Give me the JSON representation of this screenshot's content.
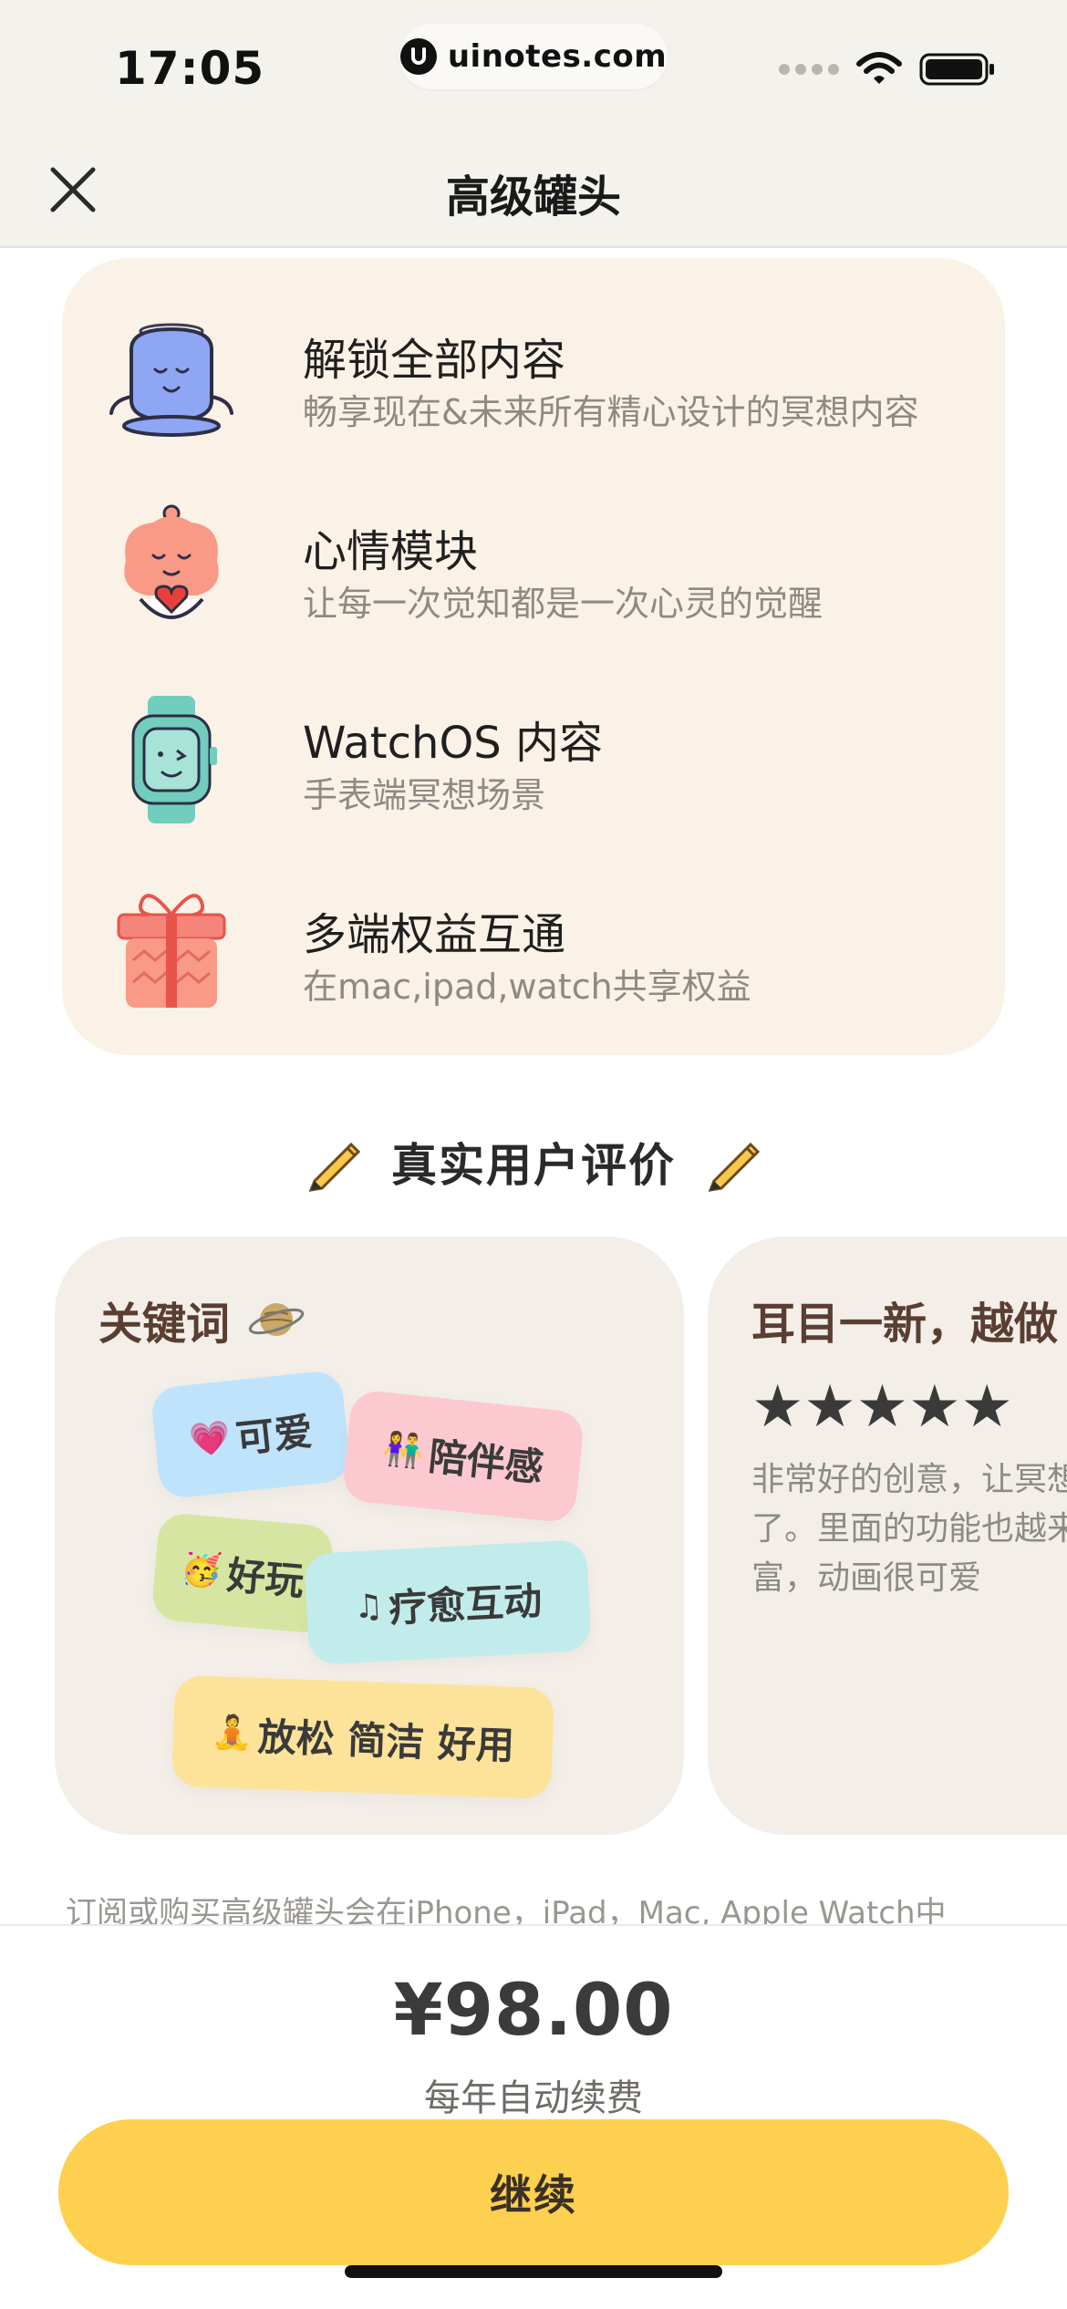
{
  "status_bar": {
    "time": "17:05",
    "url": "uinotes.com"
  },
  "nav": {
    "title": "高级罐头",
    "close_icon": "close-icon"
  },
  "features": [
    {
      "title": "解锁全部内容",
      "subtitle": "畅享现在&未来所有精心设计的冥想内容",
      "icon": "meditating-blob-icon"
    },
    {
      "title": "心情模块",
      "subtitle": "让每一次觉知都是一次心灵的觉醒",
      "icon": "mood-character-icon"
    },
    {
      "title": "WatchOS 内容",
      "subtitle": "手表端冥想场景",
      "icon": "watch-icon"
    },
    {
      "title": "多端权益互通",
      "subtitle": "在mac,ipad,watch共享权益",
      "icon": "gift-icon"
    }
  ],
  "reviews": {
    "heading": "真实用户评价",
    "keywords_card": {
      "title": "关键词",
      "tags": [
        {
          "emoji": "💗",
          "text": "可爱"
        },
        {
          "emoji": "👫",
          "text": "陪伴感"
        },
        {
          "emoji": "🥳",
          "text": "好玩"
        },
        {
          "emoji": "♫",
          "text": "疗愈互动"
        },
        {
          "emoji": "🧘",
          "text": "放松 简洁 好用"
        }
      ]
    },
    "review_card": {
      "title": "耳目一新，越做",
      "rating": 5,
      "stars": "★★★★★",
      "body": "非常好的创意，让冥想实现了。里面的功能也越来越丰富，动画很可爱"
    }
  },
  "footnote": "订阅或购买高级罐头会在iPhone，iPad，Mac, Apple Watch中",
  "purchase": {
    "price": "¥98.00",
    "price_note": "每年自动续费",
    "continue_label": "继续"
  },
  "colors": {
    "accent": "#fdd04f",
    "feature_bg": "#fbf2e7",
    "card_bg": "#f3efe8",
    "tag_blue": "#bfe3fb",
    "tag_pink": "#fbc9cf",
    "tag_green": "#d6e6a2",
    "tag_teal": "#c2eceb",
    "tag_yellow": "#fde39a"
  }
}
